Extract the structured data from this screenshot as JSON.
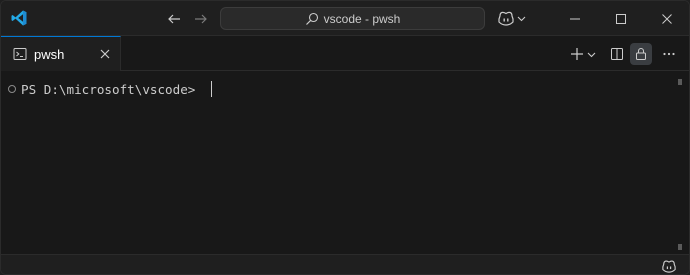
{
  "app": {
    "window_title": "vscode - pwsh",
    "logo_icon": "vscode-logo-icon",
    "accent": "#0078d4"
  },
  "titlebar": {
    "back_icon": "arrow-left-icon",
    "forward_icon": "arrow-right-icon",
    "search_icon": "search-icon",
    "copilot_icon": "copilot-icon",
    "minimize_icon": "minimize-icon",
    "maximize_icon": "maximize-icon",
    "close_icon": "close-icon"
  },
  "tabs": [
    {
      "label": "pwsh",
      "icon": "terminal-icon",
      "active": true
    }
  ],
  "toolbar": {
    "new_terminal_icon": "plus-icon",
    "split_icon": "split-editor-icon",
    "lock_icon": "lock-icon",
    "more_icon": "more-icon"
  },
  "terminal": {
    "prompt": "PS D:\\microsoft\\vscode> "
  },
  "statusbar": {
    "copilot_icon": "copilot-icon"
  }
}
